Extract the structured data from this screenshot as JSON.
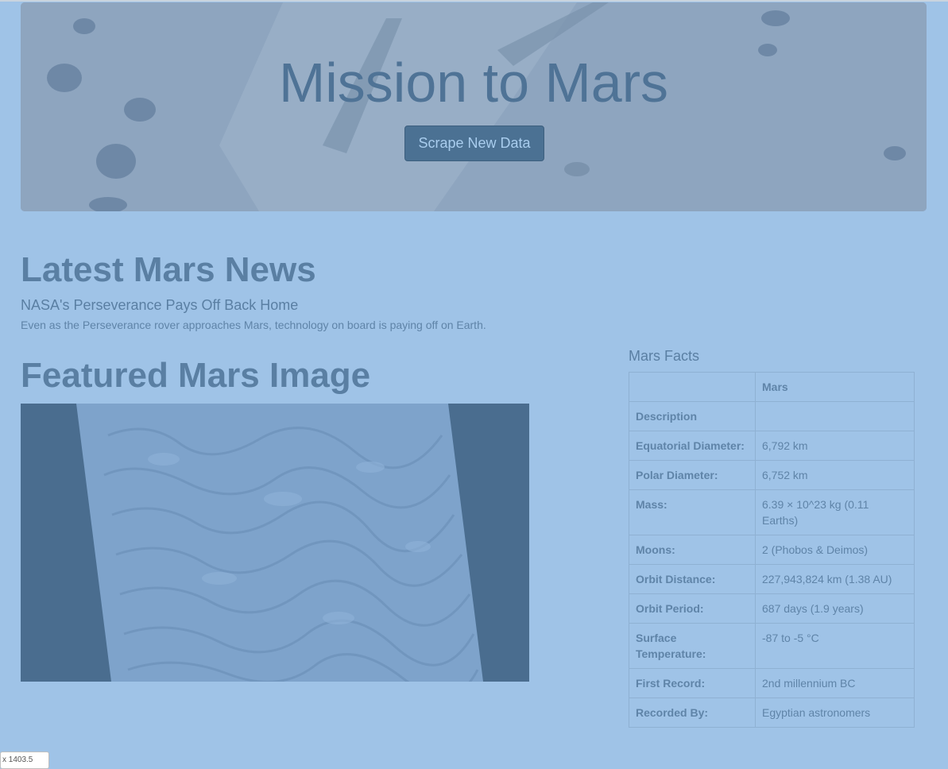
{
  "jumbotron": {
    "title": "Mission to Mars",
    "button_label": "Scrape New Data"
  },
  "news": {
    "heading": "Latest Mars News",
    "title": "NASA's Perseverance Pays Off Back Home",
    "paragraph": "Even as the Perseverance rover approaches Mars, technology on board is paying off on Earth."
  },
  "featured": {
    "heading": "Featured Mars Image"
  },
  "facts": {
    "heading": "Mars Facts",
    "column_header": "Mars",
    "rows": [
      {
        "label": "Description",
        "value": ""
      },
      {
        "label": "Equatorial Diameter:",
        "value": "6,792 km"
      },
      {
        "label": "Polar Diameter:",
        "value": "6,752 km"
      },
      {
        "label": "Mass:",
        "value": "6.39 × 10^23 kg (0.11 Earths)"
      },
      {
        "label": "Moons:",
        "value": "2 (Phobos & Deimos)"
      },
      {
        "label": "Orbit Distance:",
        "value": "227,943,824 km (1.38 AU)"
      },
      {
        "label": "Orbit Period:",
        "value": "687 days (1.9 years)"
      },
      {
        "label": "Surface Temperature:",
        "value": "-87 to -5 °C"
      },
      {
        "label": "First Record:",
        "value": "2nd millennium BC"
      },
      {
        "label": "Recorded By:",
        "value": "Egyptian astronomers"
      }
    ]
  },
  "corner_tag": "x 1403.5"
}
